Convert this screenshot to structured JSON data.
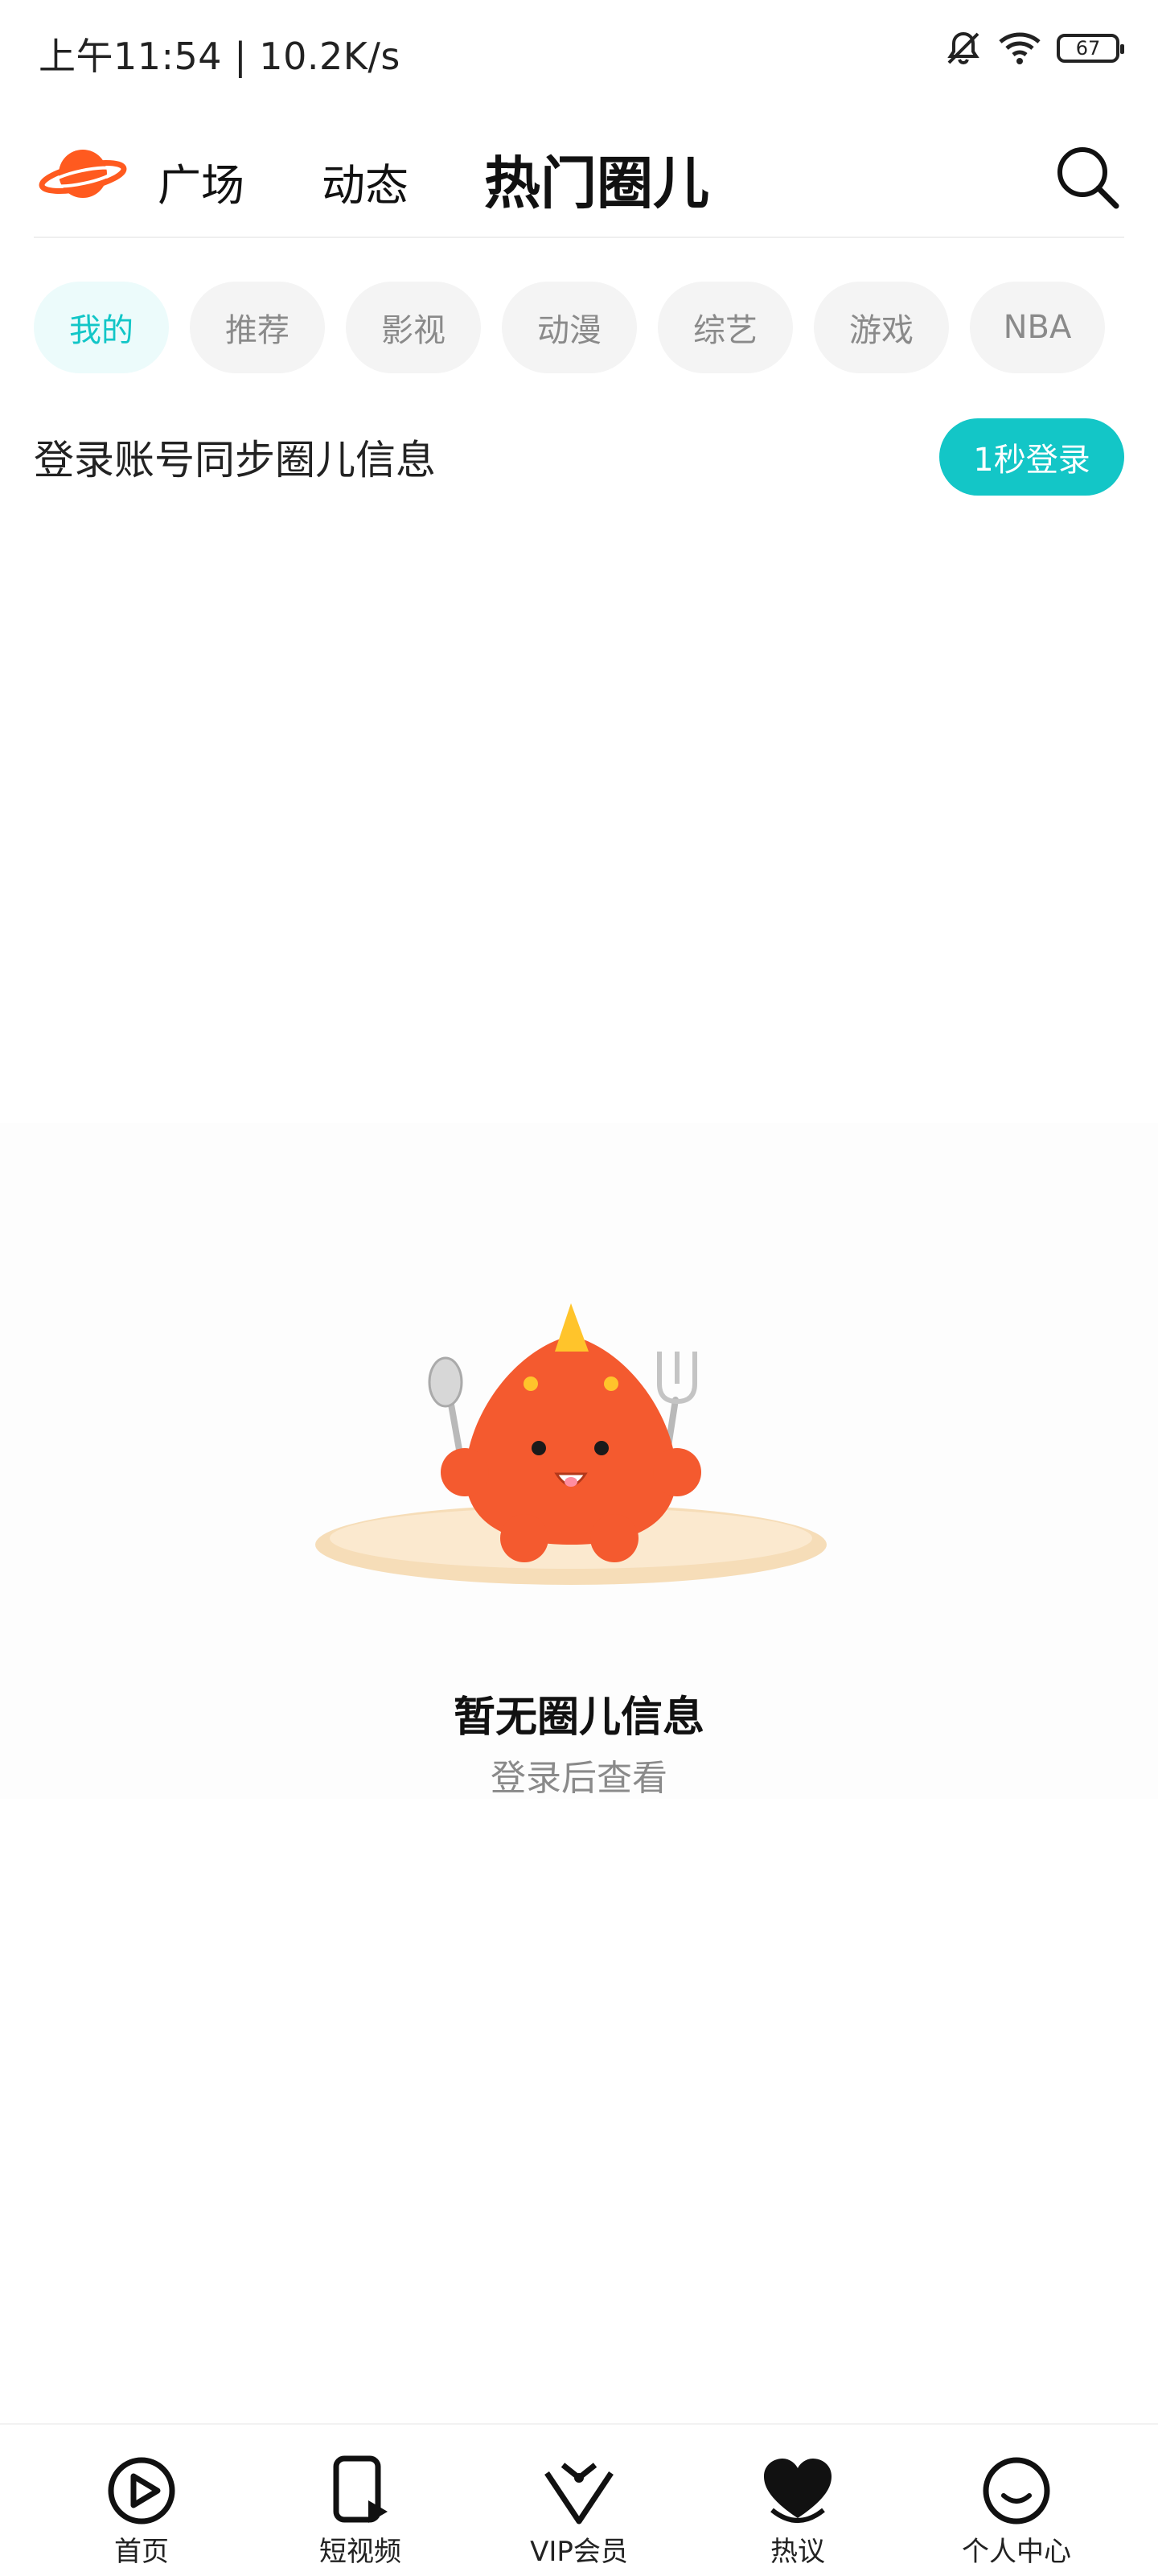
{
  "status_bar": {
    "time": "上午11:54 | 10.2K/s",
    "battery": "67",
    "icons": [
      "bell-off-icon",
      "wifi-icon",
      "battery-icon"
    ]
  },
  "header": {
    "tabs": [
      {
        "label": "广场",
        "active": false
      },
      {
        "label": "动态",
        "active": false
      },
      {
        "label": "热门圈儿",
        "active": true
      }
    ],
    "logo_icon": "planet-logo-icon",
    "search_icon": "search-icon"
  },
  "categories": [
    {
      "label": "我的",
      "active": true
    },
    {
      "label": "推荐",
      "active": false
    },
    {
      "label": "影视",
      "active": false
    },
    {
      "label": "动漫",
      "active": false
    },
    {
      "label": "综艺",
      "active": false
    },
    {
      "label": "游戏",
      "active": false
    },
    {
      "label": "NBA",
      "active": false
    }
  ],
  "login_banner": {
    "text": "登录账号同步圈儿信息",
    "button": "1秒登录"
  },
  "empty_state": {
    "title": "暂无圈儿信息",
    "subtitle": "登录后查看"
  },
  "bottom_nav": [
    {
      "label": "首页",
      "icon": "play-icon",
      "active": false
    },
    {
      "label": "短视频",
      "icon": "short-video-icon",
      "active": false
    },
    {
      "label": "VIP会员",
      "icon": "vip-icon",
      "active": false
    },
    {
      "label": "热议",
      "icon": "heart-icon",
      "active": true
    },
    {
      "label": "个人中心",
      "icon": "smile-icon",
      "active": false
    }
  ],
  "colors": {
    "accent": "#13c6c7",
    "chip_active_bg": "#ecfbfb",
    "chip_bg": "#f4f4f4",
    "logo": "#ff5a1f"
  }
}
